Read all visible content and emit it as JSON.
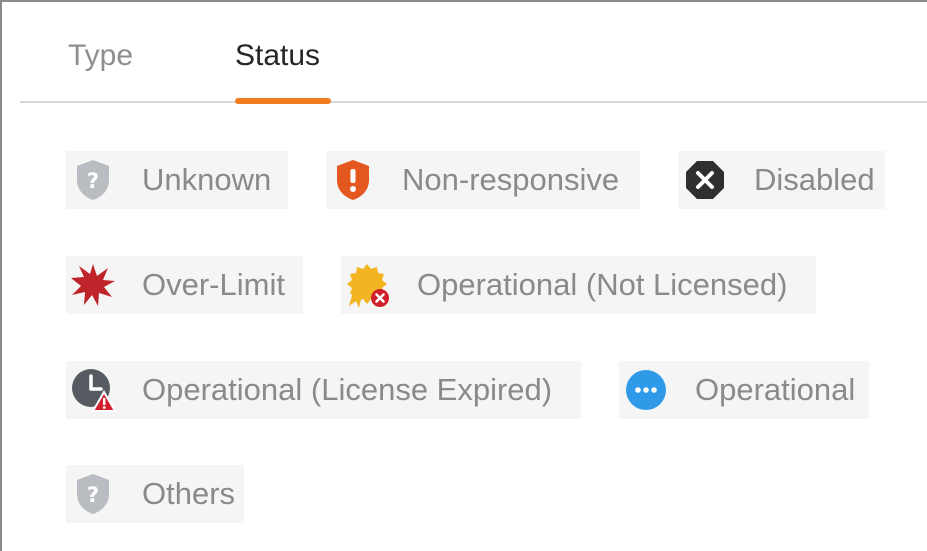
{
  "tabs": [
    {
      "label": "Type",
      "active": false
    },
    {
      "label": "Status",
      "active": true
    }
  ],
  "accent_color": "#f07c22",
  "statuses": [
    {
      "label": "Unknown",
      "icon": "question-shield-icon"
    },
    {
      "label": "Non-responsive",
      "icon": "exclamation-shield-icon"
    },
    {
      "label": "Disabled",
      "icon": "x-octagon-icon"
    },
    {
      "label": "Over-Limit",
      "icon": "burst-star-icon"
    },
    {
      "label": "Operational (Not Licensed)",
      "icon": "badge-x-icon"
    },
    {
      "label": "Operational (License Expired)",
      "icon": "clock-warning-icon"
    },
    {
      "label": "Operational",
      "icon": "ellipsis-circle-icon"
    },
    {
      "label": "Others",
      "icon": "question-shield-icon"
    }
  ]
}
